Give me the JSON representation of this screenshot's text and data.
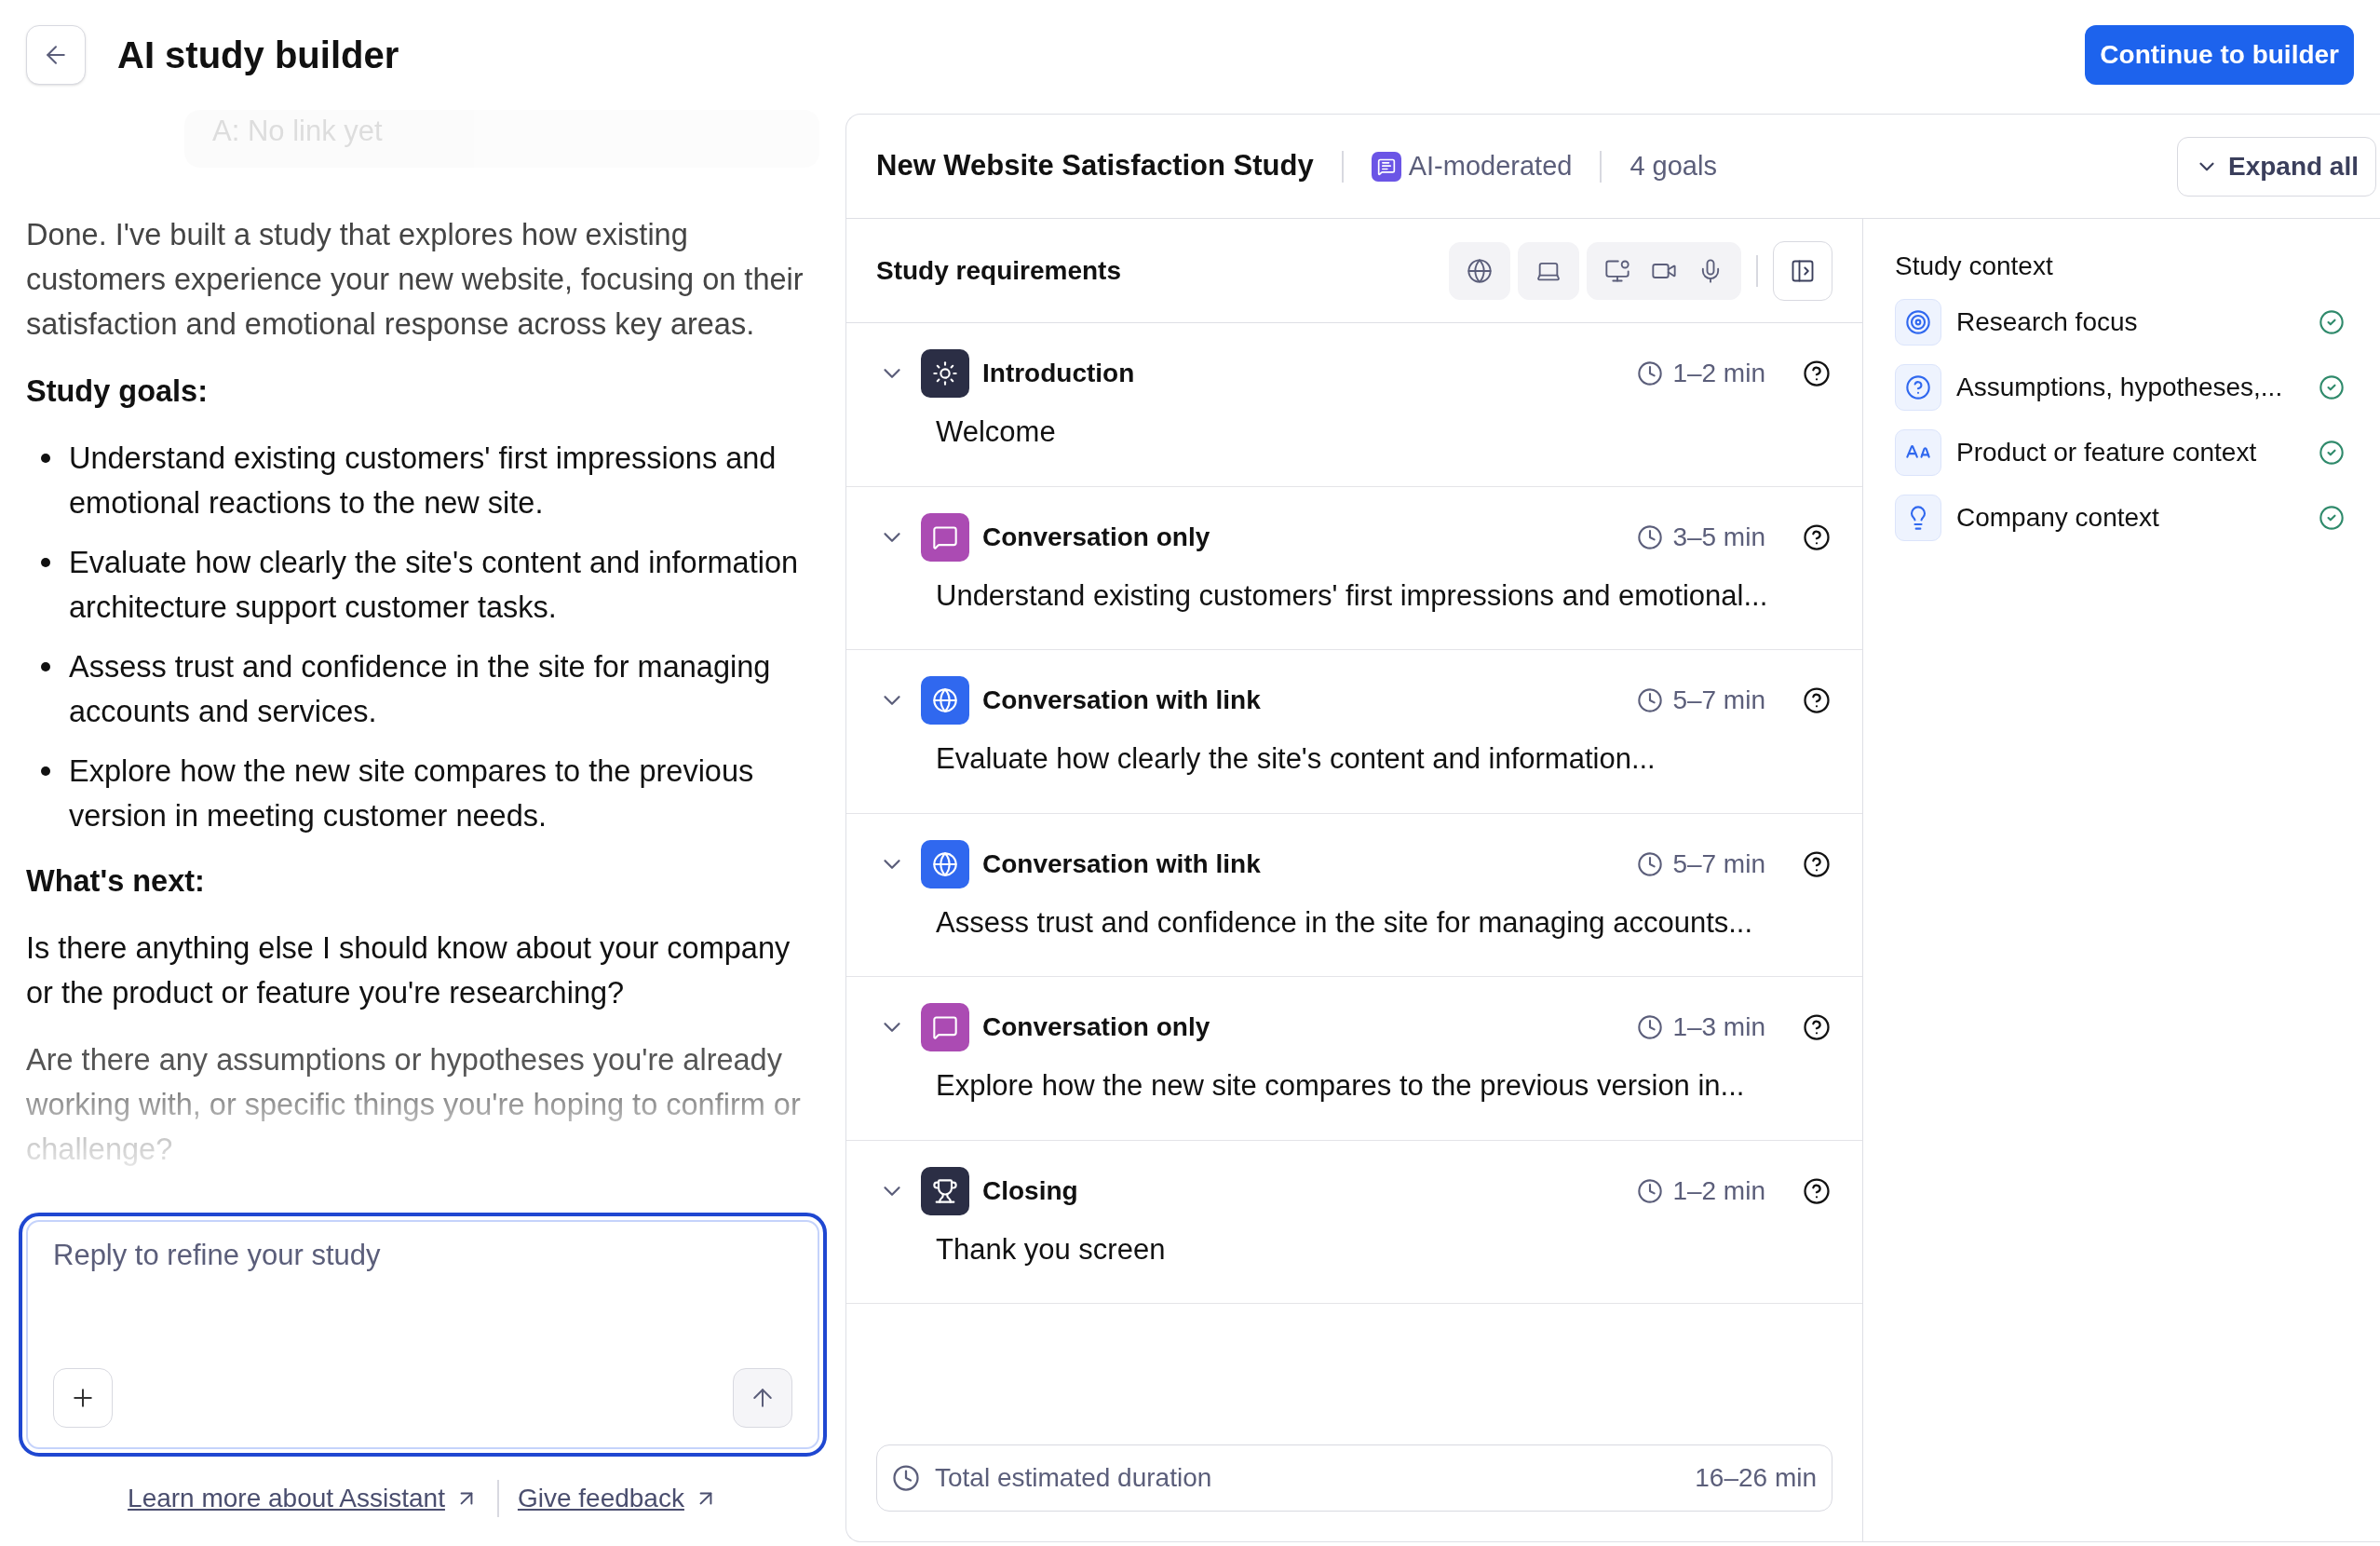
{
  "header": {
    "title": "AI study builder",
    "primary_button": "Continue to builder"
  },
  "chat": {
    "faded_answer": "A: No link yet",
    "intro": "Done. I've built a study that explores how existing customers experience your new website, focusing on their satisfaction and emotional response across key areas.",
    "goals_heading": "Study goals:",
    "goals": [
      "Understand existing customers' first impressions and emotional reactions to the new site.",
      "Evaluate how clearly the site's content and information architecture support customer tasks.",
      "Assess trust and confidence in the site for managing accounts and services.",
      "Explore how the new site compares to the previous version in meeting customer needs."
    ],
    "next_heading": "What's next:",
    "questions": [
      "Is there anything else I should know about your company or the product or feature you're researching?",
      "Are there any assumptions or hypotheses you're already working with, or specific things you're hoping to confirm or challenge?"
    ]
  },
  "composer": {
    "placeholder": "Reply to refine your study"
  },
  "footer_links": [
    "Learn more about Assistant",
    "Give feedback"
  ],
  "study": {
    "title": "New Website Satisfaction Study",
    "moderation": "AI-moderated",
    "goals": "4 goals",
    "expand_button": "Expand all",
    "requirements_title": "Study requirements",
    "modes": [
      {
        "kind": "web",
        "selected": true
      },
      {
        "kind": "device",
        "selected": true
      },
      {
        "kind": "recording",
        "selected": true
      }
    ],
    "steps": [
      {
        "kind": "intro",
        "title": "Introduction",
        "duration": "1–2 min",
        "summary": "Welcome"
      },
      {
        "kind": "conversation",
        "title": "Conversation only",
        "duration": "3–5 min",
        "summary": "Understand existing customers' first impressions and emotional..."
      },
      {
        "kind": "link",
        "title": "Conversation with link",
        "duration": "5–7 min",
        "summary": "Evaluate how clearly the site's content and information..."
      },
      {
        "kind": "link",
        "title": "Conversation with link",
        "duration": "5–7 min",
        "summary": "Assess trust and confidence in the site for managing accounts..."
      },
      {
        "kind": "conversation",
        "title": "Conversation only",
        "duration": "1–3 min",
        "summary": "Explore how the new site compares to the previous version in..."
      },
      {
        "kind": "closing",
        "title": "Closing",
        "duration": "1–2 min",
        "summary": "Thank you screen"
      }
    ],
    "total": {
      "label": "Total estimated duration",
      "value": "16–26 min"
    }
  },
  "context": {
    "title": "Study context",
    "items": [
      {
        "kind": "focus",
        "label": "Research focus",
        "done": true
      },
      {
        "kind": "assumptions",
        "label": "Assumptions, hypotheses,...",
        "done": true
      },
      {
        "kind": "product",
        "label": "Product or feature context",
        "done": true
      },
      {
        "kind": "company",
        "label": "Company context",
        "done": true
      }
    ]
  }
}
